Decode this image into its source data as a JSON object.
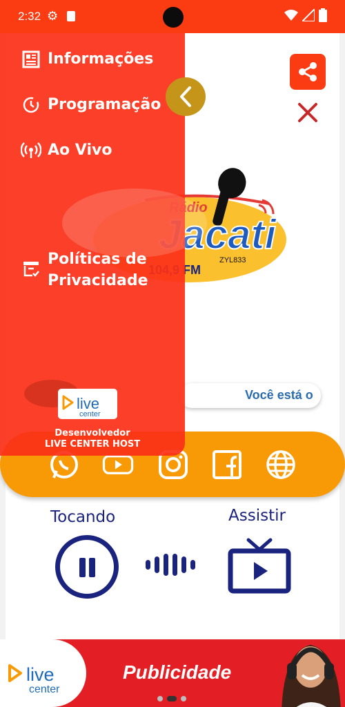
{
  "status_bar": {
    "time": "2:32"
  },
  "drawer": {
    "items": [
      {
        "label": "Informações",
        "icon": "newspaper-icon"
      },
      {
        "label": "Programação",
        "icon": "clock-icon"
      },
      {
        "label": "Ao Vivo",
        "icon": "broadcast-icon"
      },
      {
        "label": "Políticas de Privacidade",
        "line1": "Políticas de",
        "line2": "Privacidade",
        "icon": "archive-check-icon"
      }
    ],
    "developer_label": "Desenvolvedor",
    "developer_name": "LIVE CENTER HOST",
    "badge_text_live": "live",
    "badge_text_center": "center"
  },
  "station_logo": {
    "radio": "Rádio",
    "name": "Jacati",
    "frequency": "104,9 FM",
    "callsign": "ZYL833"
  },
  "marquee": {
    "text": "Você está o"
  },
  "player": {
    "playing_label": "Tocando",
    "watch_label": "Assistir"
  },
  "ad": {
    "text": "Publicidade",
    "logo_live": "live",
    "logo_center": "center"
  },
  "colors": {
    "primary": "#fb3c13",
    "accent_orange": "#f79a06",
    "navy": "#1a237e",
    "back_button": "#c5951a",
    "ad_red": "#e31e24"
  }
}
